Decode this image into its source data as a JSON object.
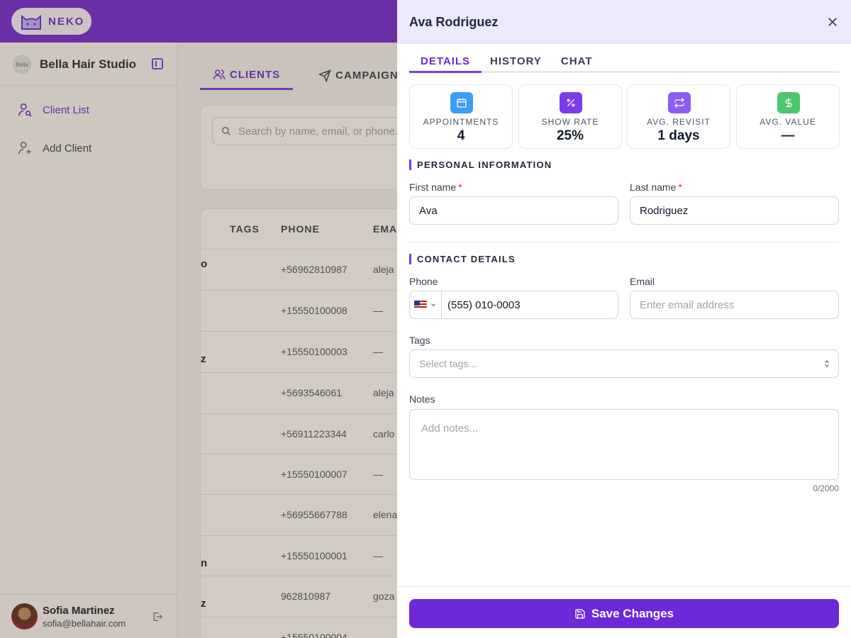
{
  "app": {
    "logo_text": "NEKO"
  },
  "sidebar": {
    "business_name": "Bella Hair Studio",
    "business_avatar_text": "Bella",
    "items": [
      {
        "label": "Client List",
        "icon": "user-search-icon",
        "active": true
      },
      {
        "label": "Add Client",
        "icon": "user-plus-icon",
        "active": false
      }
    ],
    "user": {
      "name": "Sofia Martinez",
      "email": "sofia@bellahair.com"
    }
  },
  "main": {
    "tabs": [
      {
        "label": "CLIENTS",
        "icon": "users-icon",
        "active": true
      },
      {
        "label": "CAMPAIGNS",
        "icon": "send-icon",
        "active": false
      }
    ],
    "search_placeholder": "Search by name, email, or phone...",
    "table": {
      "headers": [
        "TAGS",
        "PHONE",
        "EMAIL"
      ],
      "rows": [
        {
          "name_fragment": "o",
          "phone": "+56962810987",
          "email": "aleja"
        },
        {
          "name_fragment": "",
          "phone": "+15550100008",
          "email": "—"
        },
        {
          "name_fragment": "z",
          "phone": "+15550100003",
          "email": "—"
        },
        {
          "name_fragment": "",
          "phone": "+5693546061",
          "email": "aleja"
        },
        {
          "name_fragment": "",
          "phone": "+56911223344",
          "email": "carlo"
        },
        {
          "name_fragment": "",
          "phone": "+15550100007",
          "email": "—"
        },
        {
          "name_fragment": "",
          "phone": "+56955667788",
          "email": "elena"
        },
        {
          "name_fragment": "n",
          "phone": "+15550100001",
          "email": "—"
        },
        {
          "name_fragment": "z",
          "phone": "962810987",
          "email": "goza"
        },
        {
          "name_fragment": "",
          "phone": "+15550100004",
          "email": ""
        }
      ]
    }
  },
  "drawer": {
    "title": "Ava Rodriguez",
    "tabs": [
      {
        "label": "DETAILS",
        "active": true
      },
      {
        "label": "HISTORY",
        "active": false
      },
      {
        "label": "CHAT",
        "active": false
      }
    ],
    "stats": [
      {
        "label": "APPOINTMENTS",
        "value": "4",
        "icon": "calendar-icon",
        "color": "#3b9ef5"
      },
      {
        "label": "SHOW RATE",
        "value": "25%",
        "icon": "percent-icon",
        "color": "#7c3aed"
      },
      {
        "label": "AVG. REVISIT",
        "value": "1 days",
        "icon": "repeat-icon",
        "color": "#8b5cf6"
      },
      {
        "label": "AVG. VALUE",
        "value": "—",
        "icon": "dollar-icon",
        "color": "#4cc76b"
      }
    ],
    "personal": {
      "section_title": "PERSONAL INFORMATION",
      "first_name_label": "First name",
      "first_name_value": "Ava",
      "last_name_label": "Last name",
      "last_name_value": "Rodriguez",
      "required_mark": "*"
    },
    "contact": {
      "section_title": "CONTACT DETAILS",
      "phone_label": "Phone",
      "phone_value": "(555) 010-0003",
      "phone_country": "US",
      "email_label": "Email",
      "email_placeholder": "Enter email address",
      "tags_label": "Tags",
      "tags_placeholder": "Select tags...",
      "notes_label": "Notes",
      "notes_placeholder": "Add notes...",
      "notes_counter": "0/2000"
    },
    "save_label": "Save Changes"
  },
  "colors": {
    "brand": "#6d28d9",
    "header_bg": "#ede9fe",
    "required": "#dc2626"
  }
}
